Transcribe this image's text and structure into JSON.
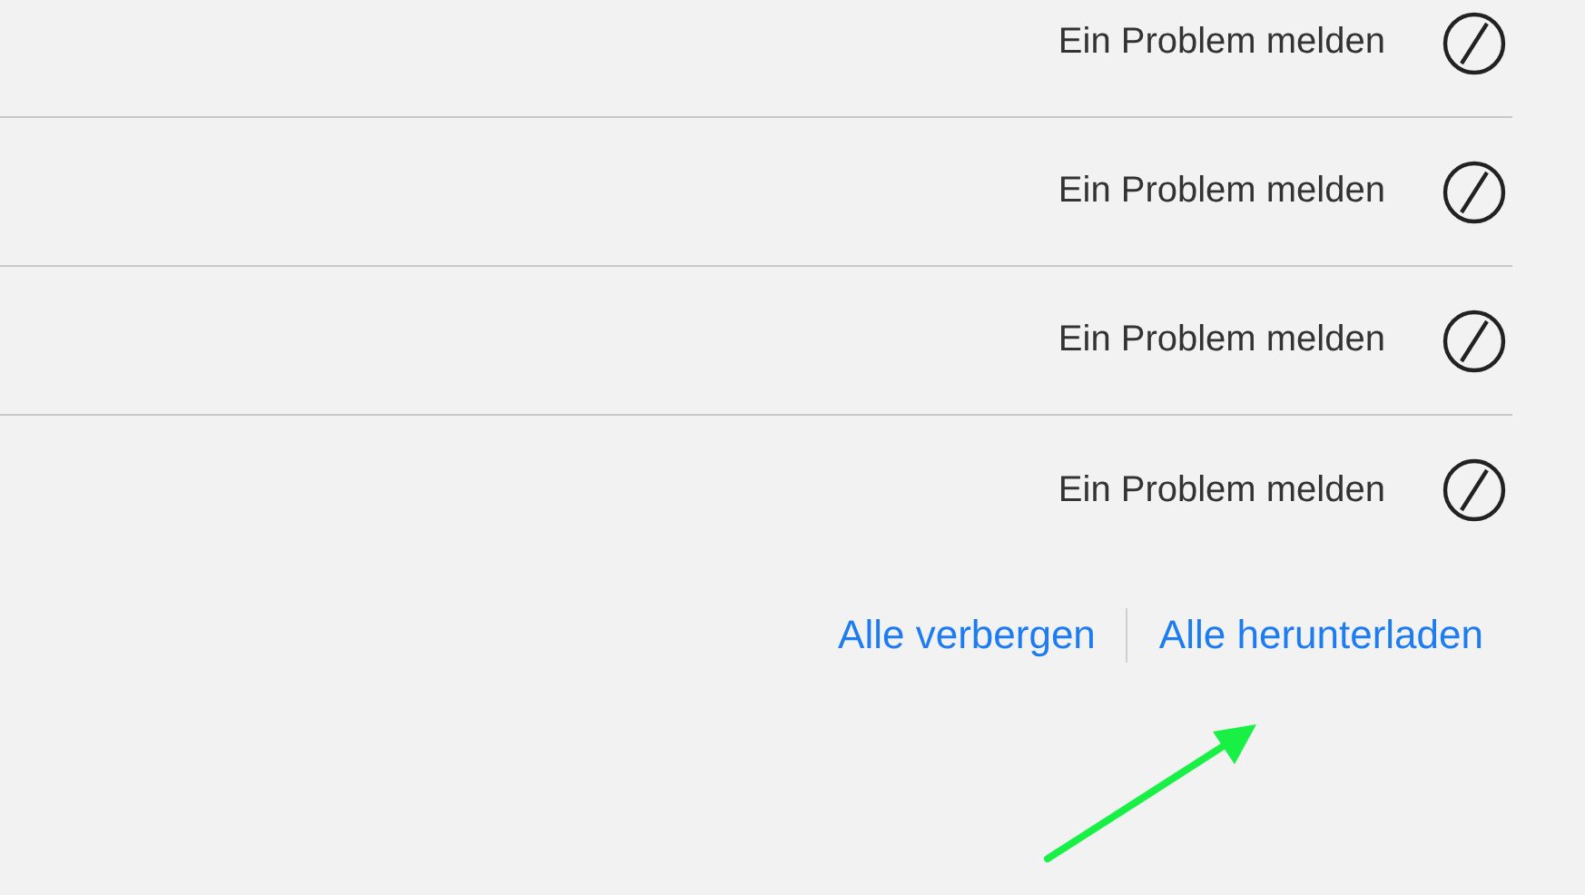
{
  "rows": [
    {
      "action": "Ein Problem melden"
    },
    {
      "action": "Ein Problem melden"
    },
    {
      "action": "Ein Problem melden"
    },
    {
      "action": "Ein Problem melden"
    }
  ],
  "links": [
    "Alle verbergen",
    "Alle herunterladen"
  ],
  "annotation": {
    "kind": "arrow",
    "color": "#19f046"
  }
}
